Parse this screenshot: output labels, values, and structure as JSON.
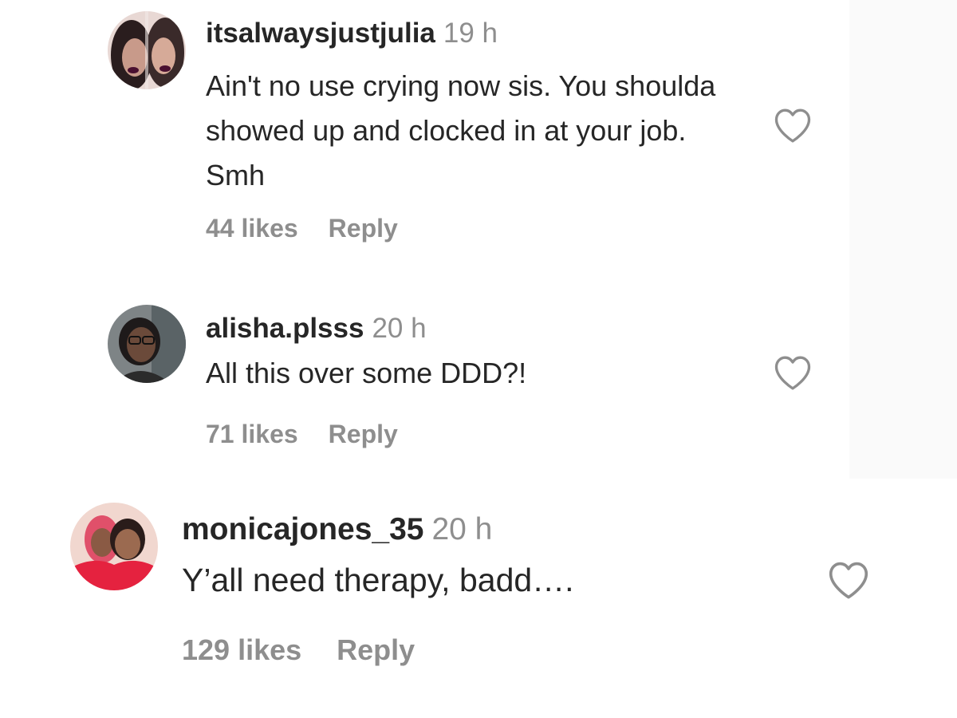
{
  "comments": [
    {
      "username": "itsalwaysjustjulia",
      "time": "19 h",
      "text": "Ain't no use crying now sis. You shoulda showed up and clocked in at your job. Smh",
      "likes": "44 likes",
      "reply": "Reply",
      "avatar": "avatar-photo"
    },
    {
      "username": "alisha.plsss",
      "time": "20 h",
      "text": "All this over some DDD?!",
      "likes": "71 likes",
      "reply": "Reply",
      "avatar": "avatar-photo"
    },
    {
      "username": "monicajones_35",
      "time": "20 h",
      "text": "Y’all need therapy, badd….",
      "likes": "129 likes",
      "reply": "Reply",
      "avatar": "avatar-photo"
    }
  ],
  "icons": {
    "like": "heart-outline-icon"
  },
  "colors": {
    "text": "#262626",
    "secondary": "#8e8e8e",
    "background": "#ffffff",
    "side_strip": "#fafafa"
  }
}
